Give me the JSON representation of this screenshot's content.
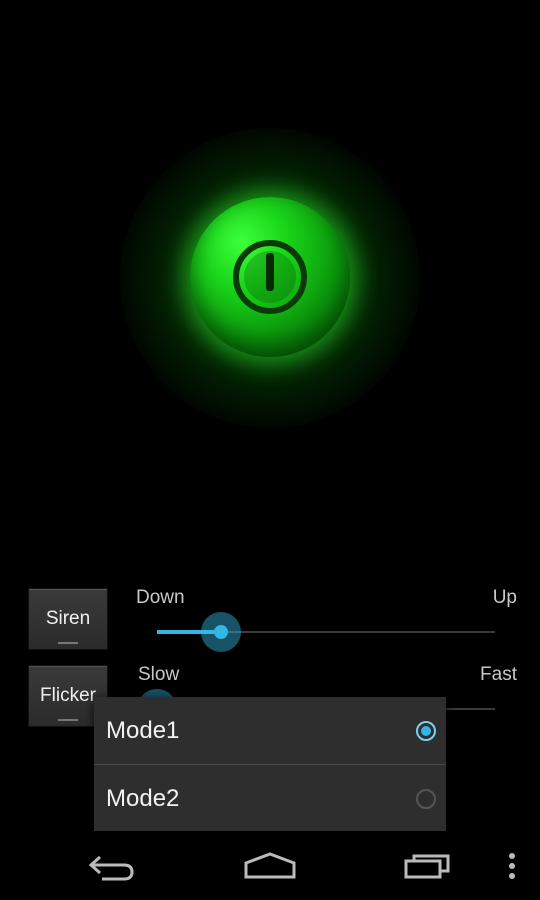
{
  "power": {
    "icon": "power-icon",
    "color": "#1ad61a"
  },
  "buttons": {
    "siren": "Siren",
    "flicker": "Flicker"
  },
  "sliders": {
    "direction": {
      "min_label": "Down",
      "max_label": "Up",
      "value": 0.19
    },
    "speed": {
      "min_label": "Slow",
      "max_label": "Fast",
      "value": 0.0
    }
  },
  "menu": {
    "items": [
      {
        "label": "Mode1",
        "selected": true
      },
      {
        "label": "Mode2",
        "selected": false
      }
    ]
  },
  "navbar": {
    "icons": [
      "back-icon",
      "home-icon",
      "recents-icon",
      "overflow-menu-icon"
    ]
  },
  "colors": {
    "accent": "#33b5e5",
    "glow": "#1ad61a",
    "background": "#000000"
  }
}
